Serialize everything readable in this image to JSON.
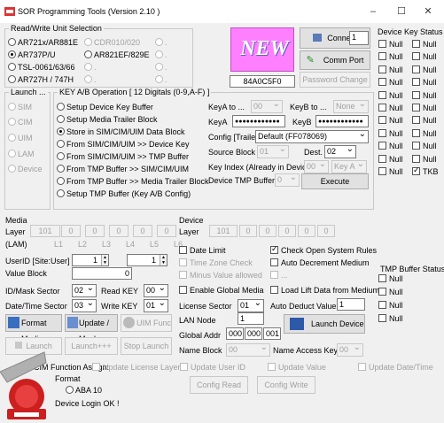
{
  "window": {
    "title": "SOR Programming Tools   (Version 2.10 )",
    "minimize": "–",
    "maximize": "☐",
    "close": "✕"
  },
  "rw_unit": {
    "legend": "Read/Write Unit Selection",
    "options": [
      "AR721x/AR881E",
      "CDR010/020",
      ".",
      "AR737P/U",
      "AR821EF/829E",
      ".",
      "TSL-0061/63/66",
      ".",
      ".",
      "AR727H / 747H",
      ".",
      "."
    ],
    "selected": "AR737P/U"
  },
  "logo_text": "NEW",
  "connect": {
    "button": "Connect",
    "port_value": "1",
    "comm_port": "Comm Port",
    "serial": "84A0C5F0",
    "password_change": "Password Change"
  },
  "device_key_status": {
    "title": "Device Key Status",
    "items": [
      "Null",
      "Null",
      "Null",
      "Null",
      "Null",
      "Null",
      "Null",
      "Null",
      "Null",
      "Null",
      "Null",
      "Null",
      "Null",
      "Null",
      "Null",
      "Null",
      "Null",
      "Null",
      "Null",
      "Null",
      "Null",
      "TKB"
    ]
  },
  "launch": {
    "legend": "Launch ...",
    "options": [
      "SIM",
      "CIM",
      "UIM",
      "LAM",
      "Device"
    ]
  },
  "key_op": {
    "legend": "KEY A/B Operation  [ 12 Digitals (0-9,A-F) ]",
    "options": [
      "Setup Device Key Buffer",
      "Setup Media Trailer Block",
      "Store in SIM/CIM/UIM Data Block",
      "From SIM/CIM/UIM  >> Device Key",
      "From SIM/CIM/UIM  >> TMP Buffer",
      "From TMP Buffer >> SIM/CIM/UIM",
      "From TMP Buffer >> Media Trailer Block",
      "Setup TMP Buffer (Key A/B  Config)"
    ],
    "selected": "Store in SIM/CIM/UIM Data Block",
    "keya_to_label": "KeyA  to ...",
    "keya_to_value": "00",
    "keyb_to_label": "KeyB  to ...",
    "keyb_to_value": "None",
    "keya_label": "KeyA",
    "keya_value": "●●●●●●●●●●●●",
    "keyb_label": "KeyB",
    "keyb_value": "●●●●●●●●●●●●",
    "config_label": "Config [Trailer]",
    "config_value": "Default (FF078069)",
    "source_label": "Source Block",
    "source_value": "01",
    "dest_label": "Dest.",
    "dest_value": "02",
    "key_index_label": "Key Index (Already in Device)",
    "key_index_value": "00",
    "key_index_type": "Key A",
    "tmp_buffer_label": "Device TMP Buffer",
    "tmp_buffer_value": "0",
    "execute": "Execute"
  },
  "media": {
    "legend": "Media",
    "layer_label": "Layer",
    "layer_values": [
      "101",
      "0",
      "0",
      "0",
      "0",
      "0"
    ],
    "lam_label": "(LAM)",
    "lam_values": [
      "L1",
      "L2",
      "L3",
      "L4",
      "L5",
      "L6"
    ],
    "userid_label": "UserID [Site:User]",
    "userid_site": "1",
    "userid_user": "1",
    "value_block_label": "Value Block",
    "value_block_value": "0",
    "id_mask_label": "ID/Mask Sector",
    "id_mask_value": "02",
    "read_key_label": "Read KEY",
    "read_key_value": "00",
    "datetime_label": "Date/Time Sector",
    "datetime_value": "03",
    "write_key_label": "Write KEY",
    "write_key_value": "01",
    "format_media": "Format Media",
    "update_mask": "Update / Mask",
    "uim_func": "UIM Func",
    "launch": "Launch",
    "launch_plus": "Launch+++",
    "stop_launch": "Stop Launch"
  },
  "device": {
    "legend": "Device",
    "layer_label": "Layer",
    "layer_values": [
      "101",
      "0",
      "0",
      "0",
      "0",
      "0"
    ],
    "date_limit": "Date Limit",
    "check_open": "Check Open System Rules",
    "time_zone": "Time Zone Check",
    "auto_decrement": "Auto Decrement Medium",
    "minus_value": "Minus Value allowed",
    "minus_extra": "...",
    "enable_global": "Enable Global Media",
    "load_lift": "Load Lift Data from Medium",
    "license_label": "License Sector",
    "license_value": "01",
    "auto_deduct_label": "Auto Deduct Value",
    "auto_deduct_value": "1",
    "lan_node_label": "LAN Node",
    "lan_node_value": "1",
    "launch_device": "Launch Device",
    "global_addr_label": "Global Addr",
    "global_addr_values": [
      "000",
      "000",
      "001"
    ],
    "name_block_label": "Name Block",
    "name_block_value": "00",
    "name_access_label": "Name Access Key",
    "name_access_value": "00"
  },
  "tmp_buffer_status": {
    "title": "TMP Buffer Status",
    "items": [
      "Null",
      "Null",
      "Null",
      "Null"
    ]
  },
  "bottom": {
    "cim_label": "CIM Function Assign:",
    "update_license": "Update License Layer",
    "update_user": "Update User ID",
    "update_value": "Update Value",
    "update_date": "Update Date/Time",
    "format_label": "Format",
    "aba10": "ABA 10",
    "config_read": "Config Read",
    "config_write": "Config Write",
    "status": "Device Login OK !"
  },
  "colors": {
    "logo_bg": "#ff80ff",
    "logo_text": "#ffffff",
    "overlay_red": "#cc1f1f"
  }
}
